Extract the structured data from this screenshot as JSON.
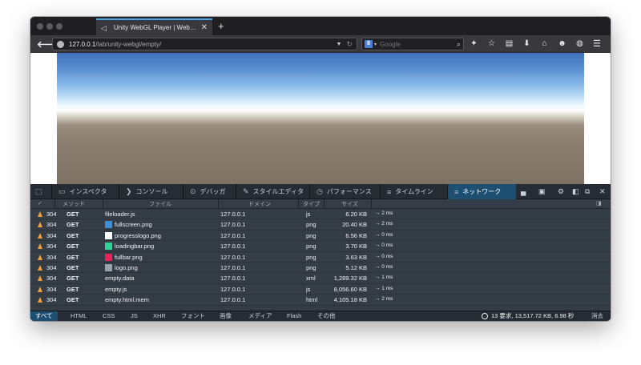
{
  "browser": {
    "tab_title": "Unity WebGL Player | Web…",
    "url_host": "127.0.0.1",
    "url_path": "/lab/unity-webgl/empty/",
    "search_placeholder": "Google",
    "search_engine_letter": "8"
  },
  "devtools": {
    "tabs": [
      {
        "label": "インスペクタ",
        "icon": "▭"
      },
      {
        "label": "コンソール",
        "icon": "❯"
      },
      {
        "label": "デバッガ",
        "icon": "⊙"
      },
      {
        "label": "スタイルエディタ",
        "icon": "✎"
      },
      {
        "label": "パフォーマンス",
        "icon": "◷"
      },
      {
        "label": "タイムライン",
        "icon": "≡"
      },
      {
        "label": "ネットワーク",
        "icon": "≡"
      }
    ],
    "active_tab": "ネットワーク",
    "columns": {
      "check": "✓",
      "method": "メソッド",
      "file": "ファイル",
      "domain": "ドメイン",
      "type": "タイプ",
      "size": "サイズ"
    },
    "requests": [
      {
        "status": "304",
        "method": "GET",
        "file": "fileloader.js",
        "domain": "127.0.0.1",
        "type": "js",
        "size": "6.20 KB",
        "timing": "→ 2 ms",
        "thumb_color": ""
      },
      {
        "status": "304",
        "method": "GET",
        "file": "fullscreen.png",
        "domain": "127.0.0.1",
        "type": "png",
        "size": "20.40 KB",
        "timing": "→ 2 ms",
        "thumb_color": "#3a8fd8"
      },
      {
        "status": "304",
        "method": "GET",
        "file": "progresslogo.png",
        "domain": "127.0.0.1",
        "type": "png",
        "size": "6.56 KB",
        "timing": "→ 0 ms",
        "thumb_color": "#ffffff"
      },
      {
        "status": "304",
        "method": "GET",
        "file": "loadingbar.png",
        "domain": "127.0.0.1",
        "type": "png",
        "size": "3.70 KB",
        "timing": "→ 0 ms",
        "thumb_color": "#2fd39a"
      },
      {
        "status": "304",
        "method": "GET",
        "file": "fullbar.png",
        "domain": "127.0.0.1",
        "type": "png",
        "size": "3.63 KB",
        "timing": "→ 0 ms",
        "thumb_color": "#f01e5a"
      },
      {
        "status": "304",
        "method": "GET",
        "file": "logo.png",
        "domain": "127.0.0.1",
        "type": "png",
        "size": "5.12 KB",
        "timing": "→ 0 ms",
        "thumb_color": "#9aa3ad"
      },
      {
        "status": "304",
        "method": "GET",
        "file": "empty.data",
        "domain": "127.0.0.1",
        "type": "xml",
        "size": "1,289.32 KB",
        "timing": "→ 1 ms",
        "thumb_color": ""
      },
      {
        "status": "304",
        "method": "GET",
        "file": "empty.js",
        "domain": "127.0.0.1",
        "type": "js",
        "size": "8,056.60 KB",
        "timing": "→ 1 ms",
        "thumb_color": ""
      },
      {
        "status": "304",
        "method": "GET",
        "file": "empty.html.mem",
        "domain": "127.0.0.1",
        "type": "html",
        "size": "4,105.18 KB",
        "timing": "→ 2 ms",
        "thumb_color": ""
      }
    ],
    "filters": [
      "すべて",
      "HTML",
      "CSS",
      "JS",
      "XHR",
      "フォント",
      "画像",
      "メディア",
      "Flash",
      "その他"
    ],
    "active_filter": "すべて",
    "summary": "13 要求, 13,517.72 KB, 6.98 秒",
    "clear_label": "消去"
  },
  "colors": {
    "accent_blue": "#1d4f73",
    "warning": "#f0a23a"
  }
}
